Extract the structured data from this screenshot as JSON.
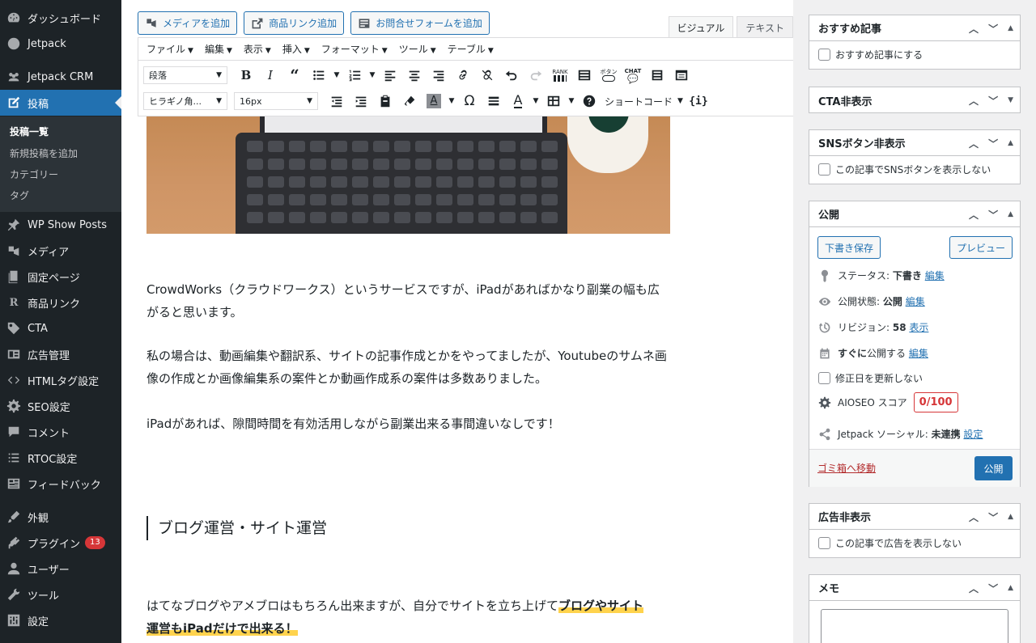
{
  "sidebar": {
    "items": [
      {
        "label": "ダッシュボード",
        "icon": "dashboard-icon"
      },
      {
        "label": "Jetpack",
        "icon": "jetpack-icon"
      },
      {
        "label": "Jetpack CRM",
        "icon": "crm-icon"
      },
      {
        "label": "投稿",
        "icon": "posts-icon"
      },
      {
        "label": "WP Show Posts",
        "icon": "pin-icon"
      },
      {
        "label": "メディア",
        "icon": "media-icon"
      },
      {
        "label": "固定ページ",
        "icon": "page-icon"
      },
      {
        "label": "商品リンク",
        "icon": "rinker-icon"
      },
      {
        "label": "CTA",
        "icon": "tag-icon"
      },
      {
        "label": "広告管理",
        "icon": "ad-icon"
      },
      {
        "label": "HTMLタグ設定",
        "icon": "code-icon"
      },
      {
        "label": "SEO設定",
        "icon": "gear-icon"
      },
      {
        "label": "コメント",
        "icon": "comment-icon"
      },
      {
        "label": "RTOC設定",
        "icon": "list-icon"
      },
      {
        "label": "フィードバック",
        "icon": "feedback-icon"
      },
      {
        "label": "外観",
        "icon": "appearance-icon"
      },
      {
        "label": "プラグイン",
        "icon": "plugin-icon",
        "badge": "13"
      },
      {
        "label": "ユーザー",
        "icon": "user-icon"
      },
      {
        "label": "ツール",
        "icon": "wrench-icon"
      },
      {
        "label": "設定",
        "icon": "settings-icon"
      }
    ],
    "submenu": [
      "投稿一覧",
      "新規投稿を追加",
      "カテゴリー",
      "タグ"
    ]
  },
  "editor": {
    "media_buttons": [
      "メディアを追加",
      "商品リンク追加",
      "お問合せフォームを追加"
    ],
    "tabs": [
      "ビジュアル",
      "テキスト"
    ],
    "menubar": [
      "ファイル",
      "編集",
      "表示",
      "挿入",
      "フォーマット",
      "ツール",
      "テーブル"
    ],
    "format_select": "段落",
    "font_select": "ヒラギノ角...",
    "size_select": "16px",
    "shortcode_label": "ショートコード",
    "toolbar_labels": {
      "rank": "RANK",
      "button": "ボタン",
      "chat": "CHAT"
    },
    "paragraphs": [
      "CrowdWorks（クラウドワークス）というサービスですが、iPadがあればかなり副業の幅も広がると思います。",
      "私の場合は、動画編集や翻訳系、サイトの記事作成とかをやってましたが、Youtubeのサムネ画像の作成とか画像編集系の案件とか動画作成系の案件は多数ありました。",
      "iPadがあれば、隙間時間を有効活用しながら副業出来る事間違いなしです！"
    ],
    "heading": "ブログ運営・サイト運営",
    "last_paragraph_plain": "はてなブログやアメブロはもちろん出来ますが、自分でサイトを立ち上げて",
    "last_paragraph_highlight_1": "ブログやサイト",
    "last_paragraph_highlight_2": "運営もiPadだけで出来る！"
  },
  "meta": {
    "recommended": {
      "title": "おすすめ記事",
      "checkbox": "おすすめ記事にする"
    },
    "cta": {
      "title": "CTA非表示"
    },
    "sns": {
      "title": "SNSボタン非表示",
      "checkbox": "この記事でSNSボタンを表示しない"
    },
    "publish": {
      "title": "公開",
      "save_draft": "下書き保存",
      "preview": "プレビュー",
      "status_label": "ステータス: ",
      "status_value": "下書き",
      "visibility_label": "公開状態: ",
      "visibility_value": "公開",
      "revision_label": "リビジョン: ",
      "revision_value": "58",
      "revision_link": "表示",
      "schedule": "すぐに",
      "schedule_suffix": "公開する",
      "edit": "編集",
      "update_date": "修正日を更新しない",
      "aioseo_label": "AIOSEO スコア",
      "aioseo_score": "0/100",
      "jetpack_label": "Jetpack ソーシャル: ",
      "jetpack_value": "未連携",
      "jetpack_link": "設定",
      "trash": "ゴミ箱へ移動",
      "publish_button": "公開"
    },
    "ads": {
      "title": "広告非表示",
      "checkbox": "この記事で広告を表示しない"
    },
    "memo": {
      "title": "メモ"
    }
  },
  "colors": {
    "accent": "#2271b1",
    "sidebar": "#1d2327",
    "highlight": "#ffd34d",
    "danger": "#d63638"
  }
}
